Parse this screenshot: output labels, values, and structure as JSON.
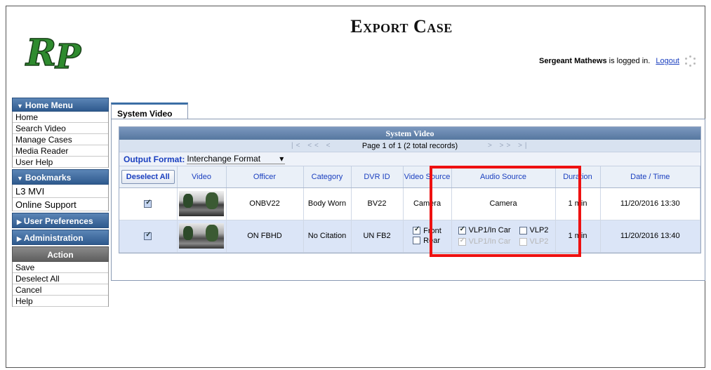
{
  "header": {
    "title": "Export Case",
    "user_name": "Sergeant Mathews",
    "logged_in_text": " is logged in.",
    "logout_label": "Logout",
    "logo_text": "RP"
  },
  "sidebar": {
    "home_menu": {
      "title": "Home Menu",
      "items": [
        "Home",
        "Search Video",
        "Manage Cases",
        "Media Reader",
        "User Help"
      ]
    },
    "bookmarks": {
      "title": "Bookmarks",
      "items": [
        "L3 MVI",
        "Online Support"
      ]
    },
    "user_preferences": "User Preferences",
    "administration": "Administration",
    "action": {
      "title": "Action",
      "items": [
        "Save",
        "Deselect All",
        "Cancel",
        "Help"
      ]
    }
  },
  "tab": {
    "label": "System Video"
  },
  "grid": {
    "title": "System Video",
    "pager_info": "Page 1 of 1 (2 total records)",
    "output_format_label": "Output Format:",
    "output_format_value": "Interchange Format",
    "columns": {
      "deselect_all": "Deselect All",
      "video": "Video",
      "officer": "Officer",
      "category": "Category",
      "dvr_id": "DVR ID",
      "video_source": "Video Source",
      "audio_source": "Audio Source",
      "duration": "Duration",
      "date_time": "Date / Time"
    },
    "rows": [
      {
        "checked": true,
        "officer": "ONBV22",
        "category": "Body Worn",
        "dvr_id": "BV22",
        "video_source": "Camera",
        "audio_source": "Camera",
        "duration": "1 min",
        "date_time": "11/20/2016 13:30"
      },
      {
        "checked": true,
        "officer": "ON FBHD",
        "category": "No Citation",
        "dvr_id": "UN FB2",
        "video_options": [
          {
            "label": "Front",
            "checked": true
          },
          {
            "label": "Rear",
            "checked": false
          }
        ],
        "audio_options": [
          {
            "label": "VLP1/In Car",
            "checked": true,
            "disabled": false
          },
          {
            "label": "VLP2",
            "checked": false,
            "disabled": false
          },
          {
            "label": "VLP1/In Car",
            "checked": true,
            "disabled": true
          },
          {
            "label": "VLP2",
            "checked": false,
            "disabled": true
          }
        ],
        "duration": "1 min",
        "date_time": "11/20/2016 13:40"
      }
    ]
  },
  "colors": {
    "header_blue": "#2f5a8e",
    "link_blue": "#1a3fbf",
    "highlight_red": "#ee1111",
    "logo_green": "#2e8b2e"
  }
}
